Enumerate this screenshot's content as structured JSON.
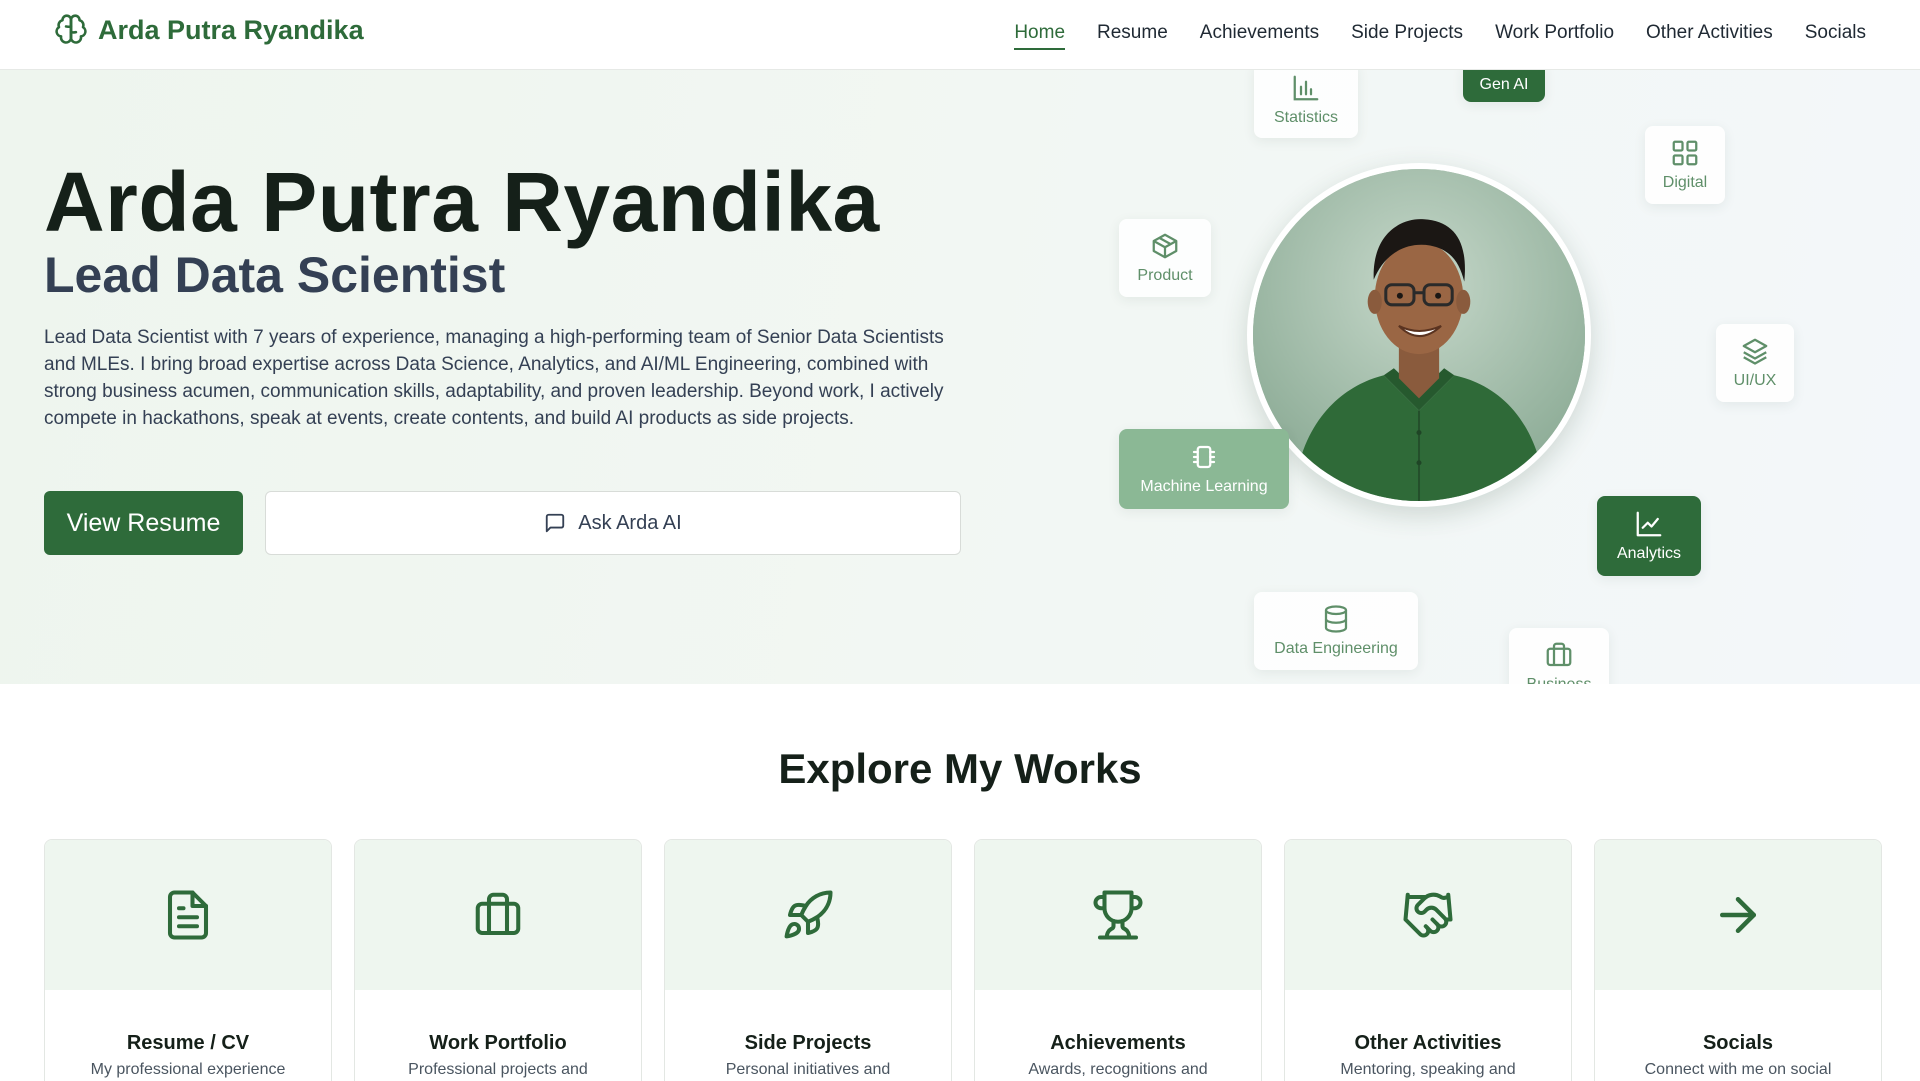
{
  "brand": {
    "name": "Arda Putra Ryandika",
    "icon": "brain-icon"
  },
  "nav": {
    "items": [
      {
        "label": "Home",
        "active": true
      },
      {
        "label": "Resume",
        "active": false
      },
      {
        "label": "Achievements",
        "active": false
      },
      {
        "label": "Side Projects",
        "active": false
      },
      {
        "label": "Work Portfolio",
        "active": false
      },
      {
        "label": "Other Activities",
        "active": false
      },
      {
        "label": "Socials",
        "active": false
      }
    ]
  },
  "hero": {
    "name": "Arda Putra Ryandika",
    "role": "Lead Data Scientist",
    "description": "Lead Data Scientist with 7 years of experience, managing a high-performing team of Senior Data Scientists and MLEs. I bring broad expertise across Data Science, Analytics, and AI/ML Engineering, combined with strong business acumen, communication skills, adaptability, and proven leadership. Beyond work, I actively compete in hackathons, speak at events, create contents, and build AI products as side projects.",
    "primary_button": "View Resume",
    "secondary_button": "Ask Arda AI",
    "secondary_icon": "chat-bubble-icon",
    "chips": [
      {
        "label": "Statistics",
        "icon": "bar-chart-icon"
      },
      {
        "label": "Gen AI",
        "icon": ""
      },
      {
        "label": "Digital",
        "icon": "grid-icon"
      },
      {
        "label": "Product",
        "icon": "box-icon"
      },
      {
        "label": "UI/UX",
        "icon": "layers-icon"
      },
      {
        "label": "Machine Learning",
        "icon": "chip-icon"
      },
      {
        "label": "Analytics",
        "icon": "line-chart-icon"
      },
      {
        "label": "Data Engineering",
        "icon": "database-icon"
      },
      {
        "label": "Business",
        "icon": "briefcase-icon"
      }
    ]
  },
  "explore": {
    "title": "Explore My Works",
    "cards": [
      {
        "title": "Resume / CV",
        "desc": "My professional experience",
        "icon": "document-icon"
      },
      {
        "title": "Work Portfolio",
        "desc": "Professional projects and",
        "icon": "briefcase-icon"
      },
      {
        "title": "Side Projects",
        "desc": "Personal initiatives and",
        "icon": "rocket-icon"
      },
      {
        "title": "Achievements",
        "desc": "Awards, recognitions and",
        "icon": "trophy-icon"
      },
      {
        "title": "Other Activities",
        "desc": "Mentoring, speaking and",
        "icon": "handshake-icon"
      },
      {
        "title": "Socials",
        "desc": "Connect with me on social",
        "icon": "arrow-right-icon"
      }
    ]
  },
  "colors": {
    "primary": "#2e6b3a",
    "accent_light": "#8bb895",
    "hero_bg": "#eef5ee",
    "card_top_bg": "#eef6ef",
    "text_dark": "#152019"
  }
}
